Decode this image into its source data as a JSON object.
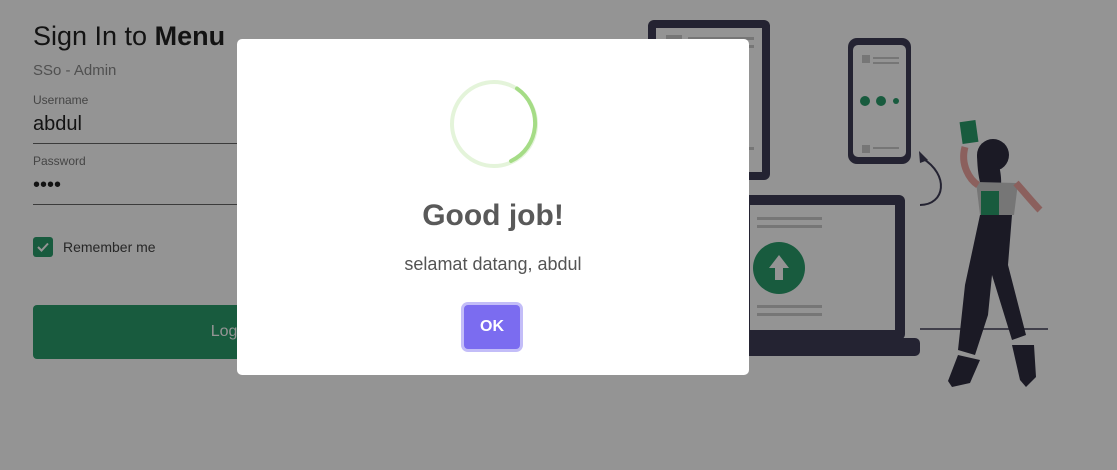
{
  "login": {
    "title_prefix": "Sign In to",
    "title_bold": "Menu",
    "subtitle": "SSo - Admin",
    "username_label": "Username",
    "username_value": "abdul",
    "password_label": "Password",
    "password_value": "••••",
    "remember_label": "Remember me",
    "remember_checked": true,
    "login_button": "Log In"
  },
  "modal": {
    "title": "Good job!",
    "text": "selamat datang, abdul",
    "ok_button": "OK"
  },
  "colors": {
    "brand_green": "#2a9d6b",
    "ok_button": "#7b6cf0",
    "success_ring": "#a5dc86"
  }
}
